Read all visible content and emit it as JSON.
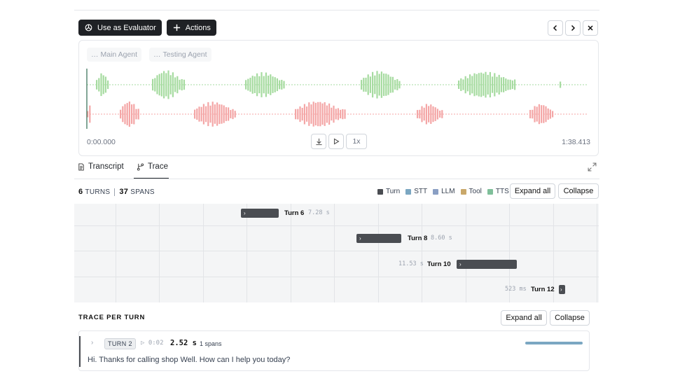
{
  "toolbar": {
    "evaluator_label": "Use as Evaluator",
    "actions_label": "Actions"
  },
  "audio": {
    "main_agent_label": "Main Agent",
    "testing_agent_label": "Testing Agent",
    "time_start": "0:00.000",
    "time_end": "1:38.413",
    "speed_label": "1x",
    "main_color": "#a6dba0",
    "testing_color": "#f4a6a6"
  },
  "tabs": {
    "transcript": "Transcript",
    "trace": "Trace"
  },
  "stats": {
    "turns_count": "6",
    "turns_label": "TURNS",
    "spans_count": "37",
    "spans_label": "SPANS"
  },
  "legend": [
    {
      "label": "Turn",
      "color": "#4a4d52"
    },
    {
      "label": "STT",
      "color": "#7ba7c2"
    },
    {
      "label": "LLM",
      "color": "#8a9fc4"
    },
    {
      "label": "Tool",
      "color": "#c9a86a"
    },
    {
      "label": "TTS",
      "color": "#7fbf9a"
    }
  ],
  "buttons": {
    "expand_all": "Expand all",
    "collapse": "Collapse"
  },
  "timeline": {
    "turns": [
      {
        "label": "Turn 6",
        "duration": "7.28 s"
      },
      {
        "label": "Turn 8",
        "duration": "8.60 s"
      },
      {
        "label": "Turn 10",
        "duration": "11.53 s"
      },
      {
        "label": "Turn 12",
        "duration": "523 ms"
      }
    ]
  },
  "trace_per_turn": {
    "title": "TRACE PER TURN",
    "turn": {
      "badge": "TURN 2",
      "time": "▷ 0:02",
      "duration": "2.52 s",
      "spans": "1 spans",
      "text": "Hi. Thanks for calling shop Well. How can I help you today?"
    }
  }
}
